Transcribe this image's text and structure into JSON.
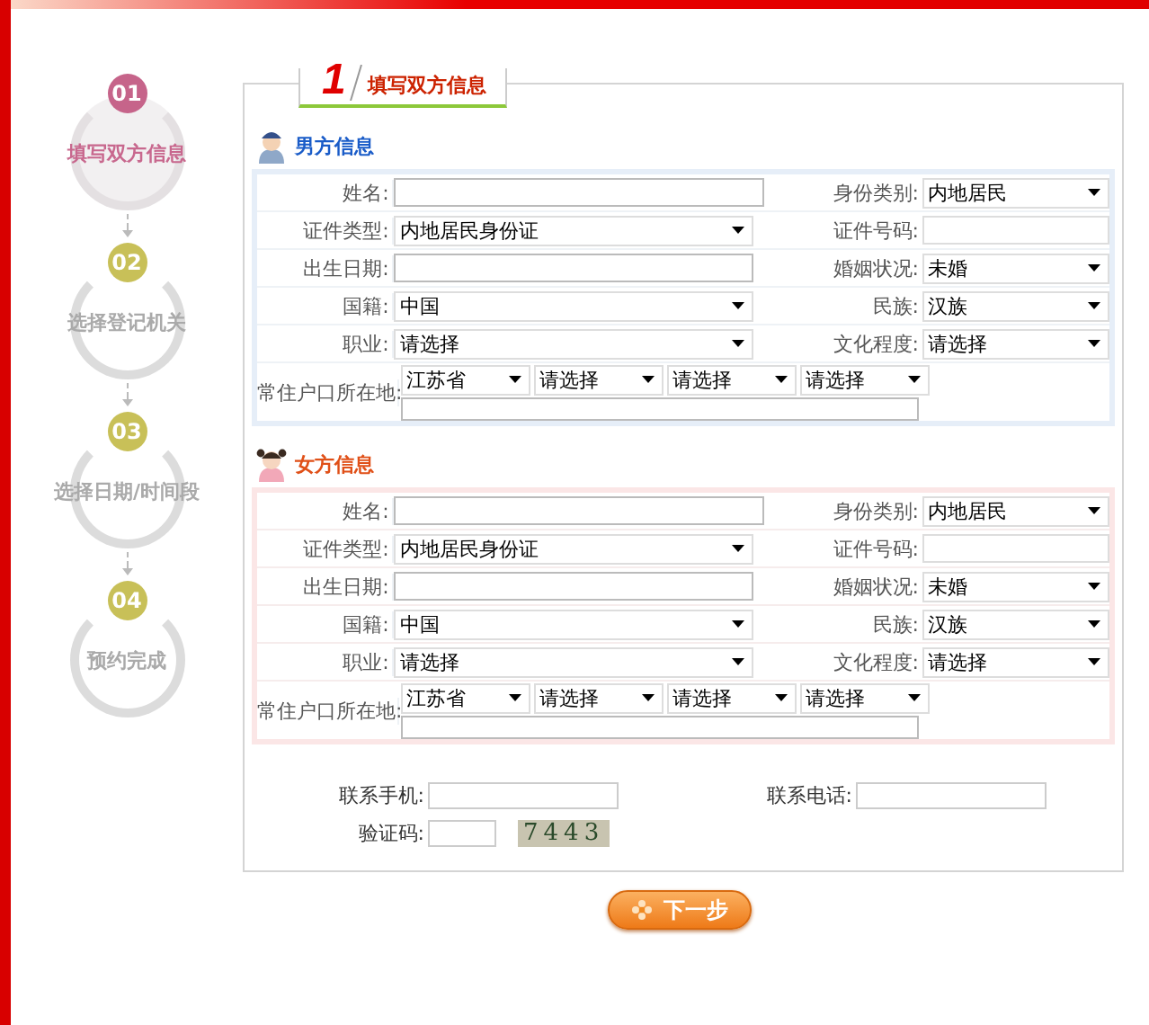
{
  "steps": [
    {
      "number": "01",
      "label": "填写双方信息",
      "selected": true
    },
    {
      "number": "02",
      "label": "选择登记机关",
      "selected": false
    },
    {
      "number": "03",
      "label": "选择日期/时间段",
      "selected": false
    },
    {
      "number": "04",
      "label": "预约完成",
      "selected": false
    }
  ],
  "tab": {
    "number": "1",
    "label": "填写双方信息"
  },
  "sections": [
    {
      "kind": "male",
      "title": "男方信息",
      "rows": [
        [
          {
            "label": "姓名:",
            "kind": "text",
            "wide": true
          },
          {
            "label": "身份类别:",
            "kind": "select",
            "value": "内地居民"
          }
        ],
        [
          {
            "label": "证件类型:",
            "kind": "select",
            "value": "内地居民身份证"
          },
          {
            "label": "证件号码:",
            "kind": "text"
          }
        ],
        [
          {
            "label": "出生日期:",
            "kind": "text"
          },
          {
            "label": "婚姻状况:",
            "kind": "select",
            "value": "未婚"
          }
        ],
        [
          {
            "label": "国籍:",
            "kind": "select",
            "value": "中国"
          },
          {
            "label": "民族:",
            "kind": "select",
            "value": "汉族"
          }
        ],
        [
          {
            "label": "职业:",
            "kind": "select",
            "value": "请选择"
          },
          {
            "label": "文化程度:",
            "kind": "select",
            "value": "请选择"
          }
        ]
      ],
      "address": {
        "label": "常住户口所在地:",
        "selects": [
          "江苏省",
          "请选择",
          "请选择",
          "请选择"
        ]
      }
    },
    {
      "kind": "female",
      "title": "女方信息",
      "rows": [
        [
          {
            "label": "姓名:",
            "kind": "text",
            "wide": true
          },
          {
            "label": "身份类别:",
            "kind": "select",
            "value": "内地居民"
          }
        ],
        [
          {
            "label": "证件类型:",
            "kind": "select",
            "value": "内地居民身份证"
          },
          {
            "label": "证件号码:",
            "kind": "text"
          }
        ],
        [
          {
            "label": "出生日期:",
            "kind": "text"
          },
          {
            "label": "婚姻状况:",
            "kind": "select",
            "value": "未婚"
          }
        ],
        [
          {
            "label": "国籍:",
            "kind": "select",
            "value": "中国"
          },
          {
            "label": "民族:",
            "kind": "select",
            "value": "汉族"
          }
        ],
        [
          {
            "label": "职业:",
            "kind": "select",
            "value": "请选择"
          },
          {
            "label": "文化程度:",
            "kind": "select",
            "value": "请选择"
          }
        ]
      ],
      "address": {
        "label": "常住户口所在地:",
        "selects": [
          "江苏省",
          "请选择",
          "请选择",
          "请选择"
        ]
      }
    }
  ],
  "contact": {
    "mobile_label": "联系手机:",
    "phone_label": "联系电话:",
    "captcha_label": "验证码:",
    "captcha": "7443"
  },
  "next_button": "下一步"
}
